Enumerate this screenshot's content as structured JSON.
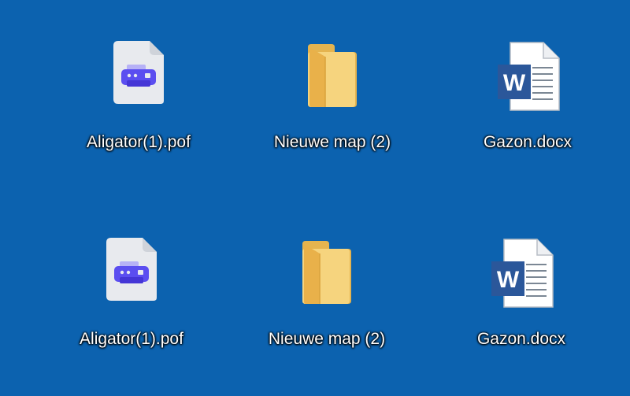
{
  "desktop": {
    "background": "#0c62af",
    "icons": [
      {
        "label": "Aligator(1).pof",
        "icon": "pdf-printer-icon"
      },
      {
        "label": "Nieuwe map (2)",
        "icon": "folder-icon"
      },
      {
        "label": "Gazon.docx",
        "icon": "word-document-icon"
      },
      {
        "label": "Aligator(1).pof",
        "icon": "pdf-printer-icon"
      },
      {
        "label": "Nieuwe map (2)",
        "icon": "folder-icon"
      },
      {
        "label": "Gazon.docx",
        "icon": "word-document-icon"
      }
    ]
  },
  "colors": {
    "printer_accent": "#5b4ef0",
    "folder": "#f6d47e",
    "word_blue": "#2b579a"
  },
  "word_letter": "W"
}
